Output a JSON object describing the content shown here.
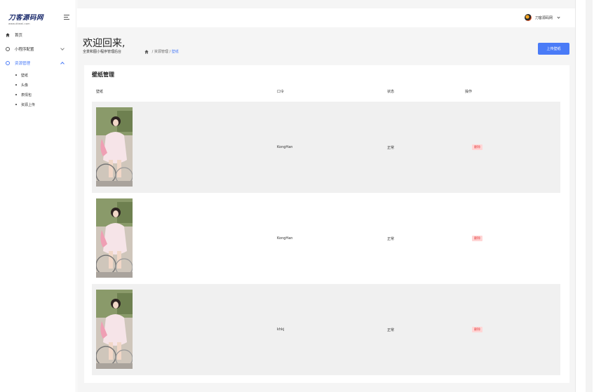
{
  "logo": {
    "main": "刀客源码网",
    "sub": "www.dkewl.com"
  },
  "sidebar": {
    "items": [
      {
        "label": "首页",
        "icon": "home-icon"
      },
      {
        "label": "小程序配置",
        "icon": "circle-icon"
      },
      {
        "label": "资源管理",
        "icon": "circle-icon",
        "active": true
      }
    ],
    "subitems": [
      {
        "label": "壁纸"
      },
      {
        "label": "头像"
      },
      {
        "label": "表情包"
      },
      {
        "label": "资源上传"
      }
    ]
  },
  "header": {
    "username": "刀客源码网"
  },
  "page": {
    "welcome": "欢迎回来,",
    "subtitle": "全景和图小程序管理后台",
    "breadcrumb": {
      "sep1": " / ",
      "b1": "资源管理",
      "sep2": " / ",
      "b2": "壁纸"
    },
    "upload_label": "上传壁纸"
  },
  "table": {
    "title": "壁纸管理",
    "columns": [
      "壁纸",
      "口令",
      "状态",
      "操作"
    ],
    "rows": [
      {
        "code": "KongHan",
        "status": "正常",
        "action": "删除"
      },
      {
        "code": "KongHan",
        "status": "正常",
        "action": "删除"
      },
      {
        "code": "khkj",
        "status": "正常",
        "action": "删除"
      }
    ]
  },
  "colors": {
    "accent": "#4a7bf7",
    "danger_bg": "#ffd6d6",
    "danger_text": "#e54545",
    "bg": "#f5f5f5"
  }
}
